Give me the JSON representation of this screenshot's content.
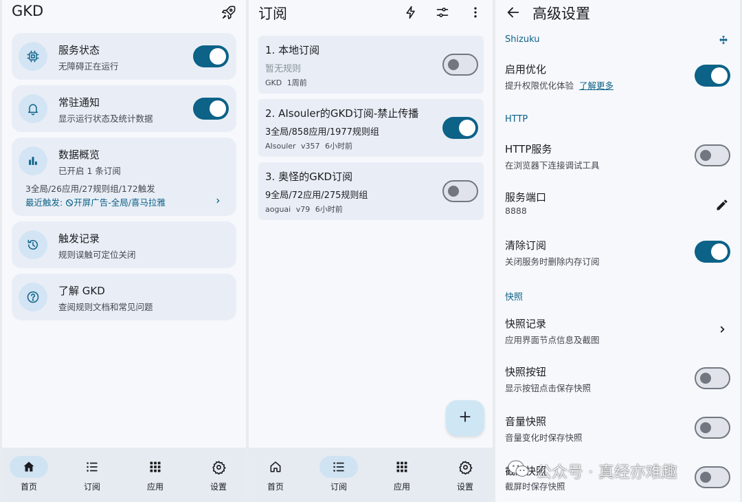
{
  "home": {
    "title": "GKD",
    "cards": [
      {
        "title": "服务状态",
        "subtitle": "无障碍正在运行",
        "switch": "on"
      },
      {
        "title": "常驻通知",
        "subtitle": "显示运行状态及统计数据",
        "switch": "on"
      },
      {
        "title": "数据概览",
        "subtitle": "已开启 1 条订阅",
        "stats": "3全局/26应用/27规则组/172触发",
        "recent_label": "最近触发:",
        "recent_value": "开屏广告-全局/喜马拉雅"
      },
      {
        "title": "触发记录",
        "subtitle": "规则误触可定位关闭"
      },
      {
        "title": "了解 GKD",
        "subtitle": "查阅规则文档和常见问题"
      }
    ]
  },
  "subs": {
    "title": "订阅",
    "items": [
      {
        "name": "1. 本地订阅",
        "desc": "暂无规则",
        "meta": "GKD 1周前",
        "switch": "off"
      },
      {
        "name": "2. AIsouler的GKD订阅-禁止传播",
        "desc": "3全局/858应用/1977规则组",
        "meta": "AIsouler v357 6小时前",
        "switch": "on"
      },
      {
        "name": "3. 奥怪的GKD订阅",
        "desc": "9全局/72应用/275规则组",
        "meta": "aoguai v79 6小时前",
        "switch": "off"
      }
    ]
  },
  "nav": [
    "首页",
    "订阅",
    "应用",
    "设置"
  ],
  "adv": {
    "title": "高级设置",
    "sec_shizuku": "Shizuku",
    "opt_title": "启用优化",
    "opt_sub": "提升权限优化体验",
    "opt_link": "了解更多",
    "sec_http": "HTTP",
    "http_title": "HTTP服务",
    "http_sub": "在浏览器下连接调试工具",
    "port_title": "服务端口",
    "port_value": "8888",
    "clear_title": "清除订阅",
    "clear_sub": "关闭服务时删除内存订阅",
    "sec_snap": "快照",
    "snaprec_title": "快照记录",
    "snaprec_sub": "应用界面节点信息及截图",
    "snapbtn_title": "快照按钮",
    "snapbtn_sub": "显示按钮点击保存快照",
    "vol_title": "音量快照",
    "vol_sub": "音量变化时保存快照",
    "shot_title": "截屏快照",
    "shot_sub": "截屏时保存快照"
  },
  "watermark": "公众号 · 真经亦难趣",
  "colors": {
    "accent": "#0c6287",
    "card": "#e9eef6",
    "background": "#f6f8fc"
  }
}
